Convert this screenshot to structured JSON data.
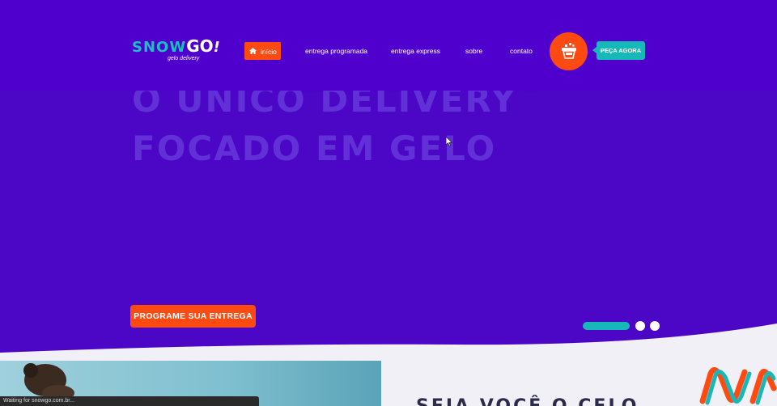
{
  "logo": {
    "word_snow": "SNOW",
    "word_go": "GO",
    "bang": "!",
    "tagline": "gelo delivery"
  },
  "nav": {
    "items": [
      {
        "label": "início",
        "active": true
      },
      {
        "label": "entrega programada"
      },
      {
        "label": "entrega express"
      },
      {
        "label": "sobre"
      },
      {
        "label": "contato"
      }
    ]
  },
  "actions": {
    "order_label": "PEÇA AGORA",
    "cart_icon": "ice-bucket-icon"
  },
  "hero": {
    "line1": "O ÚNICO DELIVERY",
    "line2": "FOCADO EM GELO",
    "cta_label": "PROGRAME SUA ENTREGA",
    "slides_total": 3,
    "active_slide": 1
  },
  "section": {
    "title": "SEJA VOCÊ O CELO"
  },
  "status": {
    "text": "Waiting for snowgo.com.br..."
  },
  "colors": {
    "brand_purple": "#4b06c6",
    "accent_orange": "#ff4a12",
    "accent_teal": "#16b9b8"
  }
}
